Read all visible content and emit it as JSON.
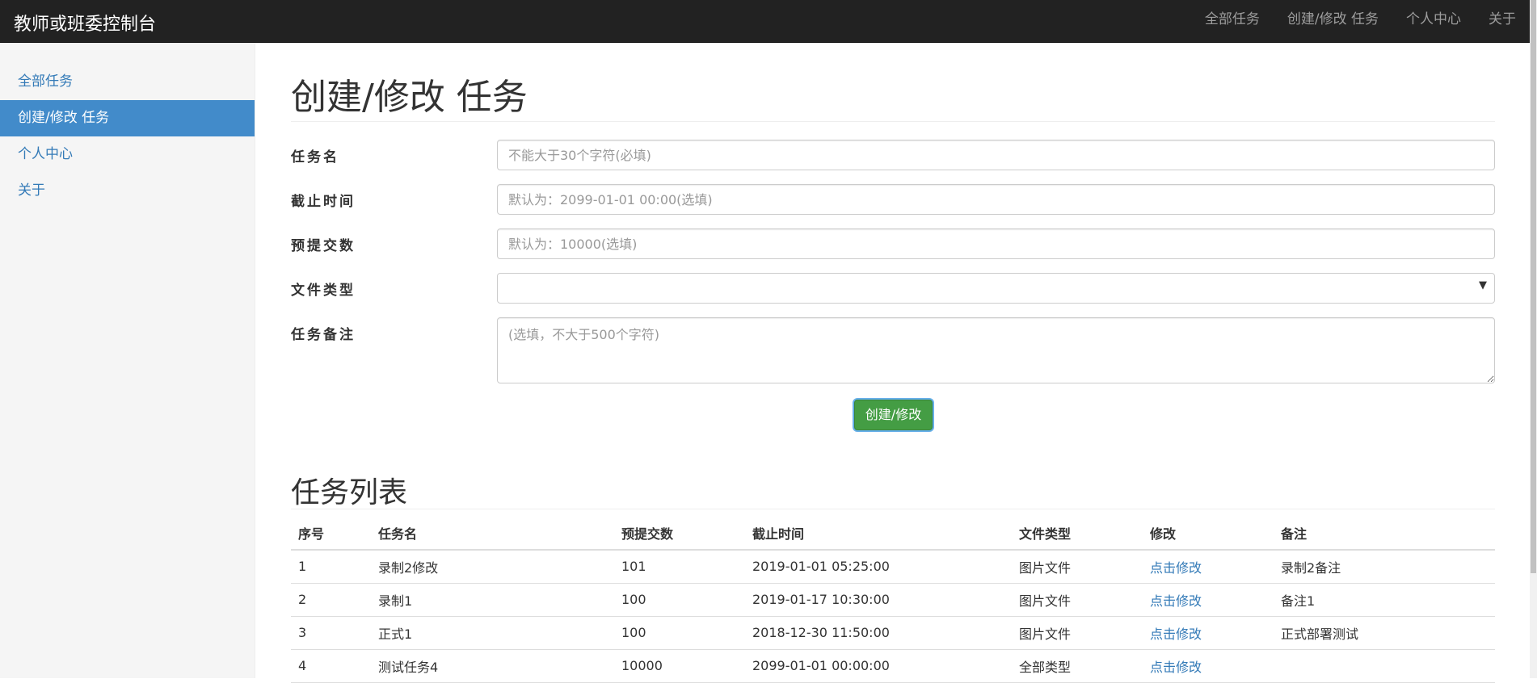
{
  "navbar": {
    "brand": "教师或班委控制台",
    "links": [
      "全部任务",
      "创建/修改 任务",
      "个人中心",
      "关于"
    ]
  },
  "sidebar": {
    "items": [
      {
        "label": "全部任务",
        "active": false
      },
      {
        "label": "创建/修改 任务",
        "active": true
      },
      {
        "label": "个人中心",
        "active": false
      },
      {
        "label": "关于",
        "active": false
      }
    ]
  },
  "page": {
    "title": "创建/修改 任务"
  },
  "form": {
    "task_name": {
      "label": "任务名",
      "value": "",
      "placeholder": "不能大于30个字符(必填)"
    },
    "deadline": {
      "label": "截止时间",
      "value": "",
      "placeholder": "默认为：2099-01-01 00:00(选填)"
    },
    "expected_count": {
      "label": "预提交数",
      "value": "",
      "placeholder": "默认为：10000(选填)"
    },
    "file_type": {
      "label": "文件类型",
      "selected": ""
    },
    "note": {
      "label": "任务备注",
      "value": "",
      "placeholder": "(选填，不大于500个字符)"
    },
    "submit_label": "创建/修改"
  },
  "task_list": {
    "title": "任务列表",
    "columns": [
      "序号",
      "任务名",
      "预提交数",
      "截止时间",
      "文件类型",
      "修改",
      "备注"
    ],
    "rows": [
      {
        "index": "1",
        "name": "录制2修改",
        "count": "101",
        "deadline": "2019-01-01 05:25:00",
        "type": "图片文件",
        "edit": "点击修改",
        "note": "录制2备注"
      },
      {
        "index": "2",
        "name": "录制1",
        "count": "100",
        "deadline": "2019-01-17 10:30:00",
        "type": "图片文件",
        "edit": "点击修改",
        "note": "备注1"
      },
      {
        "index": "3",
        "name": "正式1",
        "count": "100",
        "deadline": "2018-12-30 11:50:00",
        "type": "图片文件",
        "edit": "点击修改",
        "note": "正式部署测试"
      },
      {
        "index": "4",
        "name": "测试任务4",
        "count": "10000",
        "deadline": "2099-01-01 00:00:00",
        "type": "全部类型",
        "edit": "点击修改",
        "note": ""
      }
    ]
  },
  "colors": {
    "navbar_bg": "#222222",
    "sidebar_active": "#428bca",
    "link": "#337ab7",
    "success": "#449d44"
  }
}
